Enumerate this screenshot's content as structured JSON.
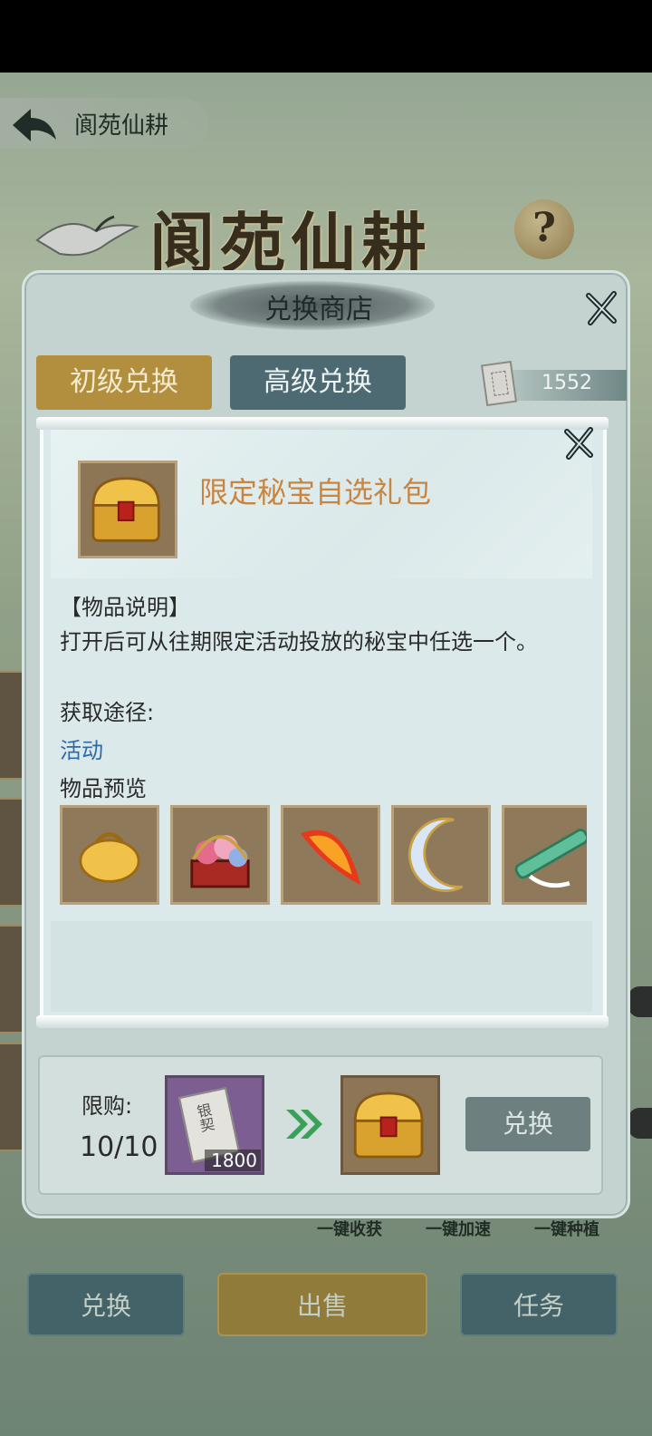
{
  "topbar": {
    "title": "阆苑仙耕"
  },
  "banner": {
    "title": "阆苑仙耕",
    "help_glyph": "?"
  },
  "scene": {
    "quick_actions": [
      "一键收获",
      "一键加速",
      "一键种植"
    ],
    "buttons": {
      "exchange": "兑换",
      "sell": "出售",
      "task": "任务"
    }
  },
  "shop": {
    "title": "兑换商店",
    "tabs": [
      {
        "label": "初级兑换",
        "active": true
      },
      {
        "label": "高级兑换",
        "active": false
      }
    ],
    "currency": {
      "value": "1552",
      "icon": "silver-note-icon"
    },
    "purchase": {
      "limit_label": "限购:",
      "limit_value": "10/10",
      "cost_item_text": "银契",
      "cost_quantity": "1800",
      "exchange_label": "兑换"
    }
  },
  "detail": {
    "item_name": "限定秘宝自选礼包",
    "desc_heading": "【物品说明】",
    "desc_text": "打开后可从往期限定活动投放的秘宝中任选一个。",
    "source_heading": "获取途径:",
    "source_link": "活动",
    "preview_heading": "物品预览",
    "preview_items": [
      "gold-pouch-icon",
      "flower-basket-icon",
      "fire-feather-icon",
      "crescent-moon-icon",
      "jade-flute-icon"
    ]
  },
  "colors": {
    "accent_gold": "#b18f3e",
    "item_name": "#c9853f",
    "link": "#2d6aa8",
    "dialog_bg": "#c4d3cf"
  }
}
